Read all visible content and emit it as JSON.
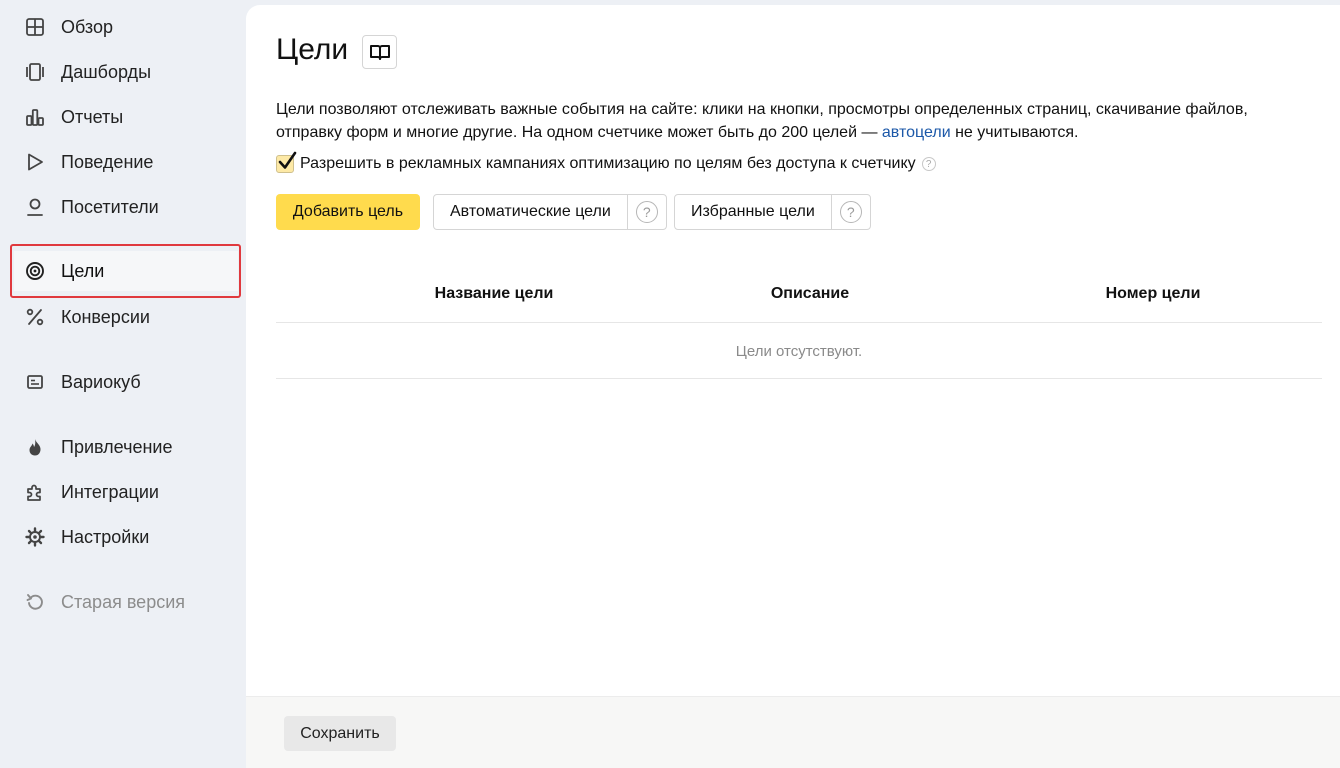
{
  "sidebar": {
    "items": [
      {
        "label": "Обзор",
        "icon": "grid-icon"
      },
      {
        "label": "Дашборды",
        "icon": "dashboards-icon"
      },
      {
        "label": "Отчеты",
        "icon": "bar-chart-icon"
      },
      {
        "label": "Поведение",
        "icon": "play-icon"
      },
      {
        "label": "Посетители",
        "icon": "person-icon"
      },
      {
        "label": "Цели",
        "icon": "target-icon",
        "active": true
      },
      {
        "label": "Конверсии",
        "icon": "percent-icon"
      },
      {
        "label": "Вариокуб",
        "icon": "table-icon"
      },
      {
        "label": "Привлечение",
        "icon": "fire-icon"
      },
      {
        "label": "Интеграции",
        "icon": "puzzle-icon"
      },
      {
        "label": "Настройки",
        "icon": "gear-icon"
      },
      {
        "label": "Старая версия",
        "icon": "undo-icon"
      }
    ]
  },
  "main": {
    "title": "Цели",
    "description_part1": "Цели позволяют отслеживать важные события на сайте: клики на кнопки, просмотры определенных страниц, скачивание файлов, отправку форм и многие другие. На одном счетчике может быть до 200 целей — ",
    "description_link": "автоцели",
    "description_part2": " не учитываются.",
    "checkbox_label": "Разрешить в рекламных кампаниях оптимизацию по целям без доступа к счетчику",
    "checkbox_checked": true,
    "add_goal_button": "Добавить цель",
    "auto_goals_button": "Автоматические цели",
    "favorite_goals_button": "Избранные цели",
    "help_symbol": "?",
    "table": {
      "columns": [
        "Название цели",
        "Описание",
        "Номер цели"
      ],
      "empty_text": "Цели отсутствуют."
    },
    "save_button": "Сохранить"
  },
  "colors": {
    "accent_yellow": "#ffdb4d",
    "link_blue": "#1c58a8",
    "active_outline": "#e0393e",
    "sidebar_bg": "#edf0f5"
  }
}
